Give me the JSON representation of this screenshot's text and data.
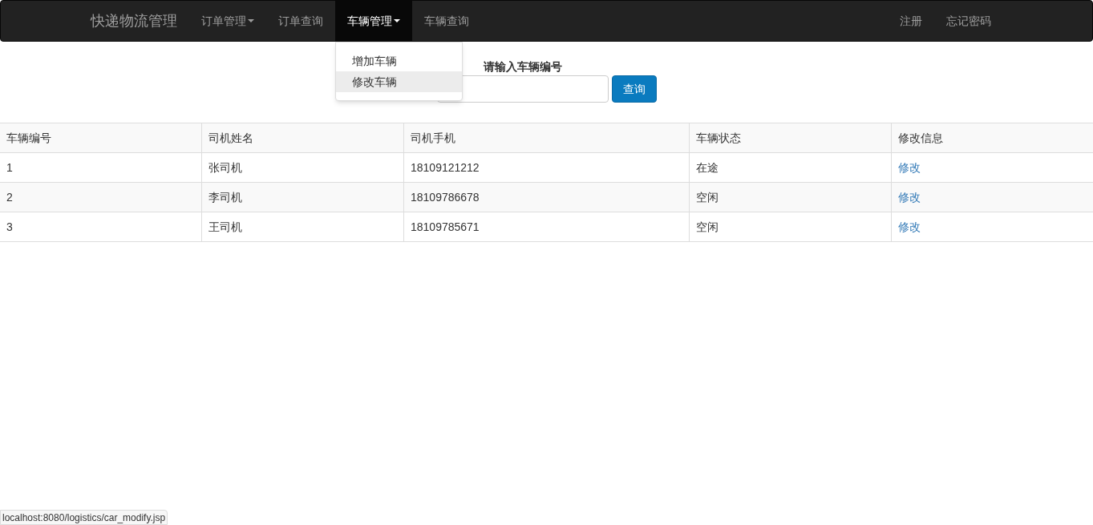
{
  "navbar": {
    "brand": "快递物流管理",
    "items": [
      {
        "label": "订单管理",
        "kind": "dropdown",
        "selected": false
      },
      {
        "label": "订单查询",
        "kind": "link",
        "selected": false
      },
      {
        "label": "车辆管理",
        "kind": "dropdown",
        "selected": true,
        "expanded": true,
        "menu": [
          {
            "label": "增加车辆",
            "selected": false
          },
          {
            "label": "修改车辆",
            "selected": true
          }
        ]
      },
      {
        "label": "车辆查询",
        "kind": "link",
        "selected": false
      }
    ],
    "right_items": [
      "注册",
      "忘记密码"
    ]
  },
  "search": {
    "label": "请输入车辆编号",
    "button": "查询"
  },
  "table": {
    "columns": [
      "车辆编号",
      "司机姓名",
      "司机手机",
      "车辆状态",
      "修改信息"
    ],
    "rows": [
      [
        "1",
        "张司机",
        "18109121212",
        "在途",
        "修改"
      ],
      [
        "2",
        "李司机",
        "18109786678",
        "空闲",
        "修改"
      ],
      [
        "3",
        "王司机",
        "18109785671",
        "空闲",
        "修改"
      ]
    ]
  },
  "status_bar": "localhost:8080/logistics/car_modify.jsp"
}
